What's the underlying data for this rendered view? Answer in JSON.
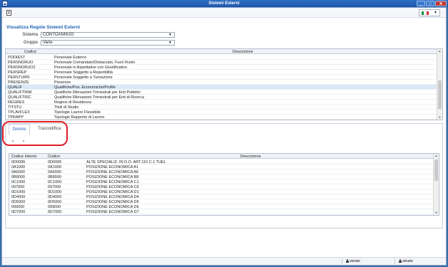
{
  "window": {
    "title": "Sistemi Esterni"
  },
  "language": {
    "flag_colors": [
      "#009246",
      "#ffffff",
      "#ce2b37"
    ]
  },
  "section_title": "Visualizza Regole Sistemi Esterni",
  "filters": {
    "sistema": {
      "label": "Sistema",
      "value": "CONTOANNUO"
    },
    "gruppo": {
      "label": "Gruppo",
      "value": "Varie"
    }
  },
  "regole_grid": {
    "columns": [
      "Codice",
      "Descrizione"
    ],
    "rows": [
      {
        "codice": "PODIEST",
        "descrizione": "Personale Esterno"
      },
      {
        "codice": "PERSNORUO",
        "descrizione": "Personale Comandato/Distaccato, Fuori Ruolo"
      },
      {
        "codice": "PERSNORUO2",
        "descrizione": "Personale in Aspettative con Giustificativo"
      },
      {
        "codice": "PERSREP",
        "descrizione": "Personale Soggetto a Reperibilità"
      },
      {
        "codice": "PERSTURN",
        "descrizione": "Personale Soggetto a Turnazione"
      },
      {
        "codice": "PRESENZE",
        "descrizione": "Presenze"
      },
      {
        "codice": "QUALIF",
        "descrizione": "Qualifiche/Pos. Economiche/Profilo"
      },
      {
        "codice": "QUALIFTRIM",
        "descrizione": "Qualifiche Rilevazioni Trimestrali per Enti Pubblici"
      },
      {
        "codice": "QUALIFTRIC",
        "descrizione": "Qualifiche Rilevazioni Trimestrali per Enti di Ricerca"
      },
      {
        "codice": "REGRES",
        "descrizione": "Regioni di Residenza"
      },
      {
        "codice": "TITSTU",
        "descrizione": "Titoli di Studio"
      },
      {
        "codice": "TPLAVFLEX",
        "descrizione": "Tipologie Lavoro Flessibile"
      },
      {
        "codice": "TPRAPP",
        "descrizione": "Tipologie Rapporto di Lavoro"
      }
    ],
    "selected_index": 6
  },
  "tabs": [
    {
      "label": "Domini"
    },
    {
      "label": "Trascodifica"
    }
  ],
  "domini_grid": {
    "columns": [
      "Codice interno",
      "Codice",
      "Descrizione"
    ],
    "rows": [
      {
        "interno": "0D0095",
        "codice": "0D0095",
        "descrizione": "ALTE SPECIALIZ. IN D.O. ART.110 C.1 TUEL"
      },
      {
        "interno": "0A1000",
        "codice": "0A1000",
        "descrizione": "POSIZIONE ECONOMICA A1"
      },
      {
        "interno": "0A6000",
        "codice": "0A6000",
        "descrizione": "POSIZIONE ECONOMICA A6"
      },
      {
        "interno": "0B8000",
        "codice": "0B8000",
        "descrizione": "POSIZIONE ECONOMICA B8"
      },
      {
        "interno": "0C1000",
        "codice": "0C1000",
        "descrizione": "POSIZIONE ECONOMICA C1"
      },
      {
        "interno": "097000",
        "codice": "097000",
        "descrizione": "POSIZIONE ECONOMICA C6"
      },
      {
        "interno": "0D1000",
        "codice": "0D1000",
        "descrizione": "POSIZIONE ECONOMICA D1"
      },
      {
        "interno": "0D4000",
        "codice": "0D4000",
        "descrizione": "POSIZIONE ECONOMICA D4"
      },
      {
        "interno": "0D5000",
        "codice": "0D5000",
        "descrizione": "POSIZIONE ECONOMICA D5"
      },
      {
        "interno": "099000",
        "codice": "099000",
        "descrizione": "POSIZIONE ECONOMICA D6"
      },
      {
        "interno": "0D7000",
        "codice": "0D7000",
        "descrizione": "POSIZIONE ECONOMICA D7"
      }
    ]
  },
  "statusbar": {
    "user1": "steate",
    "user2": "steate"
  }
}
